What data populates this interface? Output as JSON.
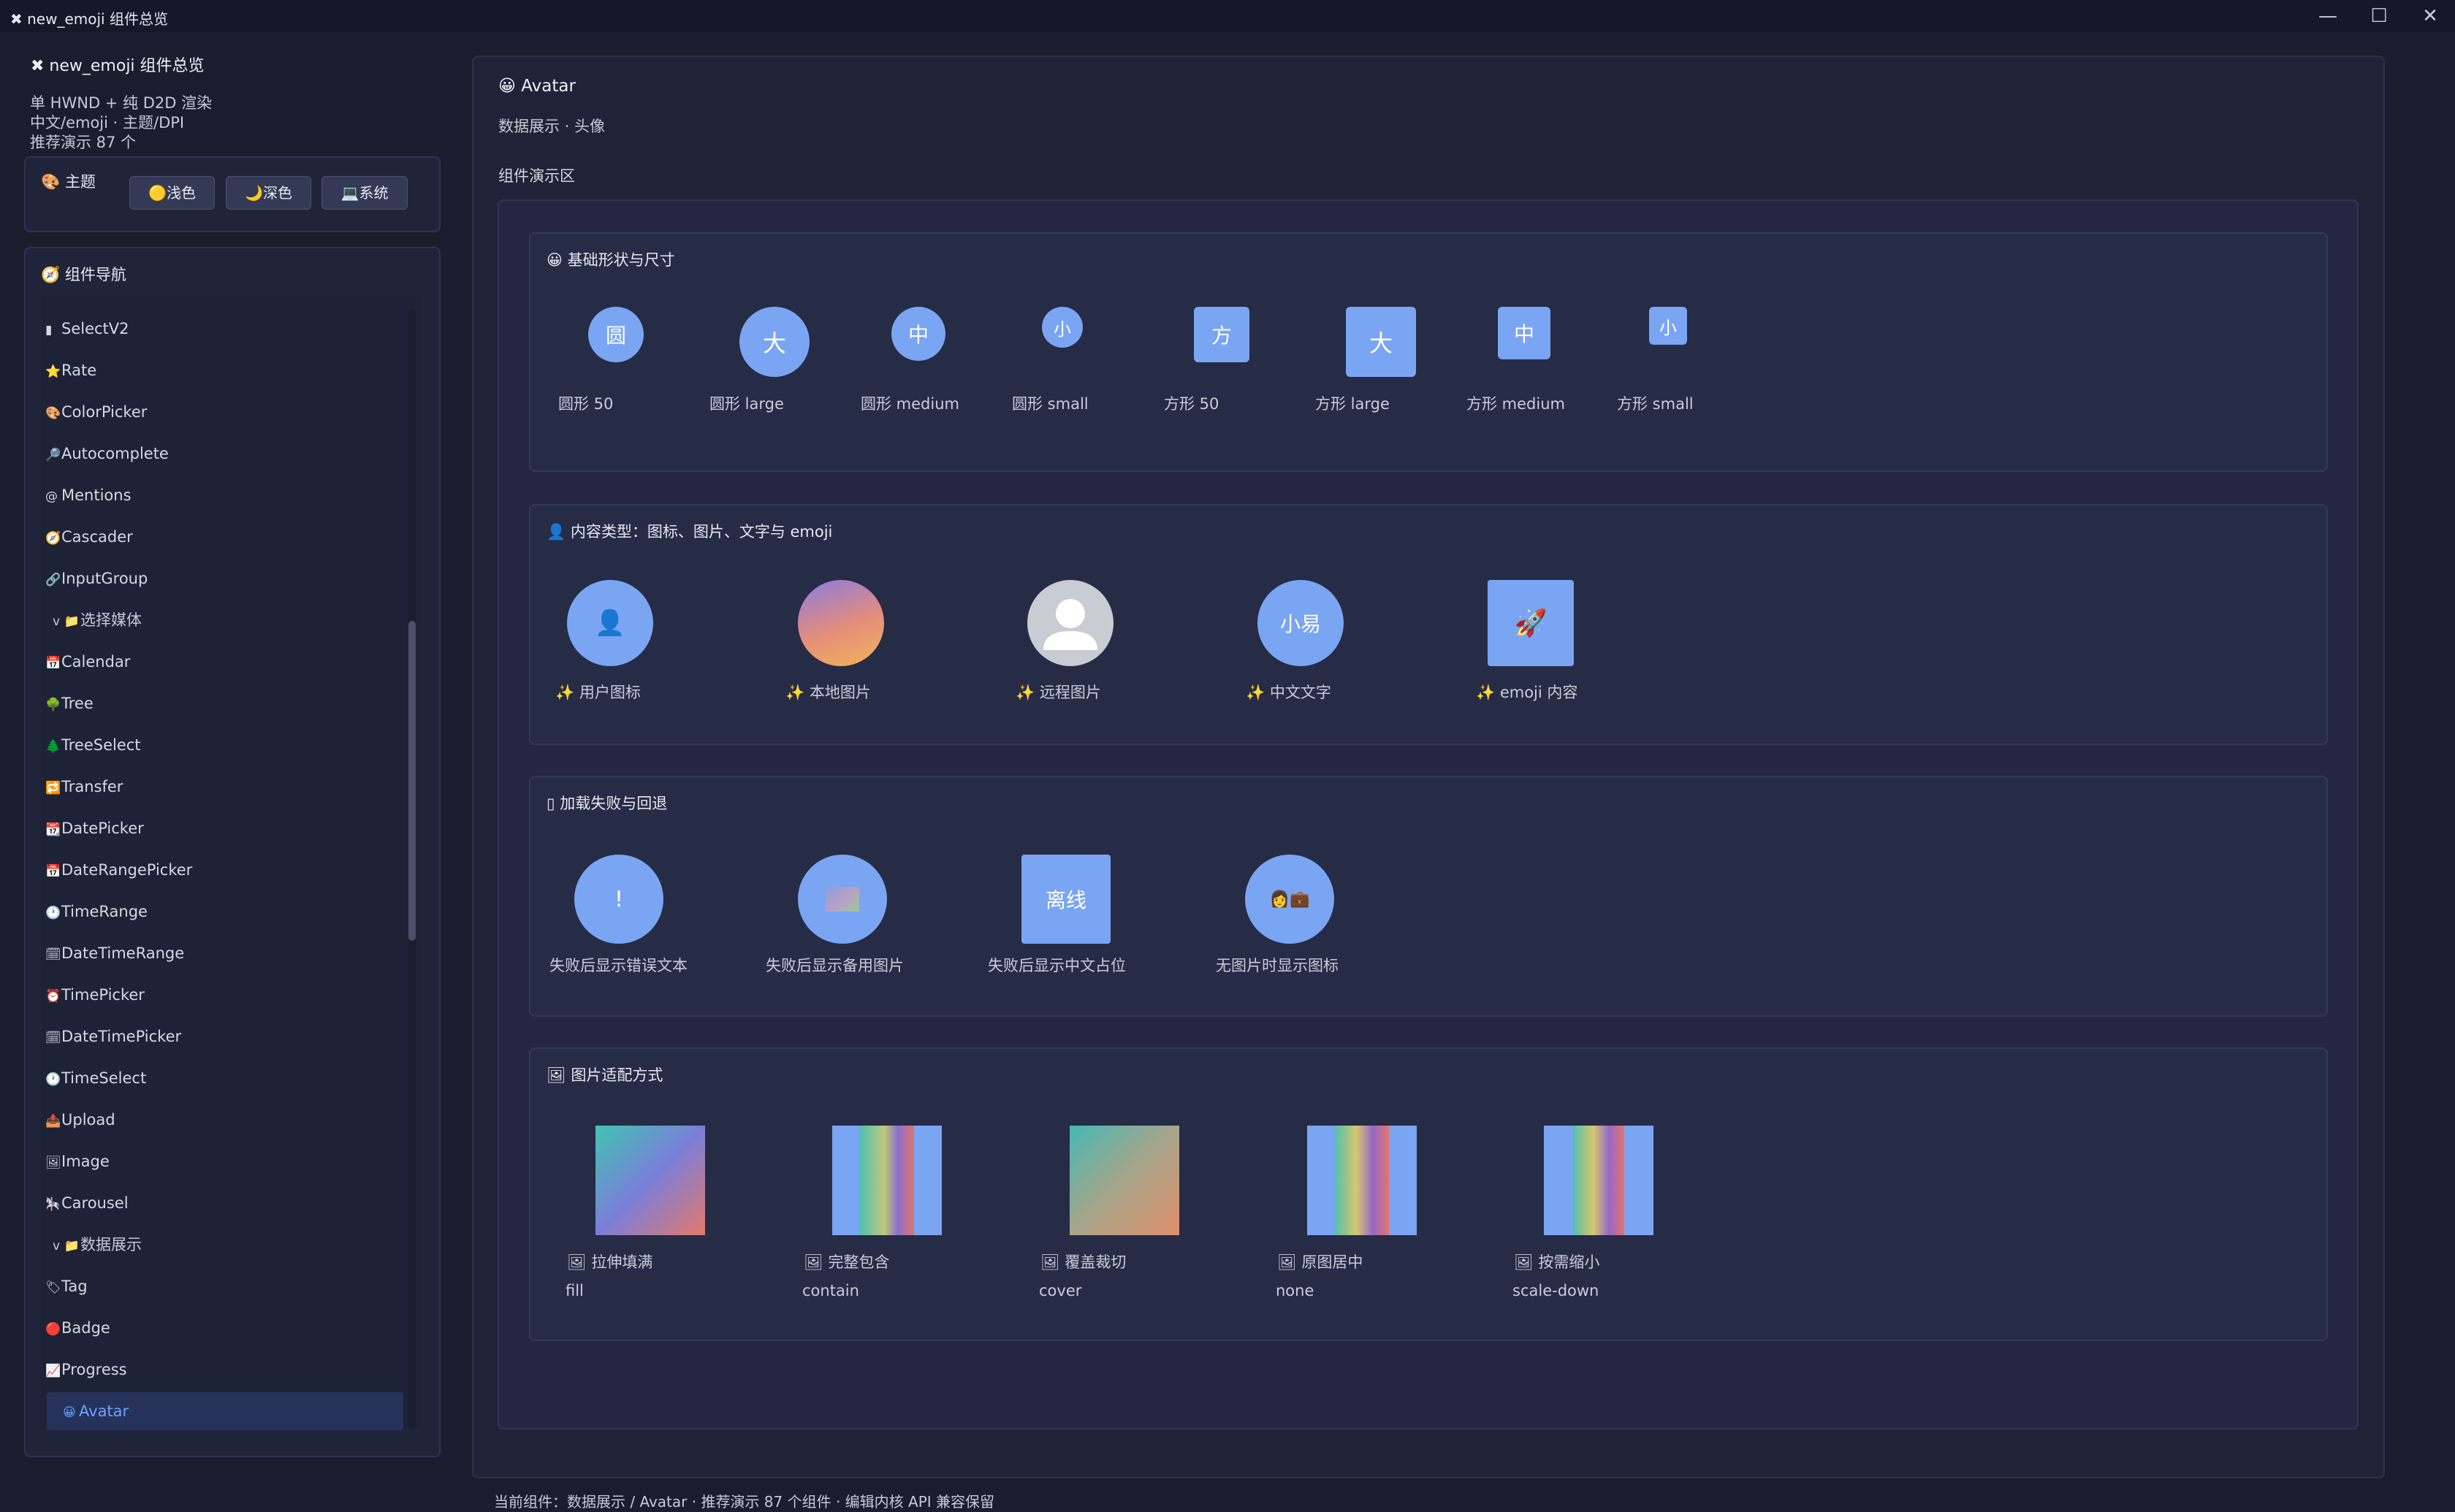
{
  "window": {
    "title": "✖ new_emoji 组件总览",
    "min": "—",
    "max": "☐",
    "close": "✕"
  },
  "sidebar": {
    "title": "✖ new_emoji 组件总览",
    "lines": [
      "单 HWND + 纯 D2D 渲染",
      "中文/emoji · 主题/DPI",
      "推荐演示 87 个"
    ],
    "theme": {
      "label": "🎨 主题",
      "buttons": [
        "🟡浅色",
        "🌙深色",
        "💻系统"
      ]
    },
    "nav": {
      "label": "🧭 组件导航",
      "items": [
        {
          "icon": "▮",
          "label": "SelectV2"
        },
        {
          "icon": "⭐",
          "label": "Rate"
        },
        {
          "icon": "🎨",
          "label": "ColorPicker"
        },
        {
          "icon": "🔎",
          "label": "Autocomplete"
        },
        {
          "icon": "@",
          "label": "Mentions"
        },
        {
          "icon": "🧭",
          "label": "Cascader"
        },
        {
          "icon": "🔗",
          "label": "InputGroup"
        },
        {
          "icon": "v 📁",
          "label": "选择媒体",
          "group": true
        },
        {
          "icon": "📅",
          "label": "Calendar"
        },
        {
          "icon": "🌳",
          "label": "Tree"
        },
        {
          "icon": "🌲",
          "label": "TreeSelect"
        },
        {
          "icon": "🔁",
          "label": "Transfer"
        },
        {
          "icon": "📆",
          "label": "DatePicker"
        },
        {
          "icon": "📅",
          "label": "DateRangePicker"
        },
        {
          "icon": "🕐",
          "label": "TimeRange"
        },
        {
          "icon": "🗓",
          "label": "DateTimeRange"
        },
        {
          "icon": "⏰",
          "label": "TimePicker"
        },
        {
          "icon": "🗓",
          "label": "DateTimePicker"
        },
        {
          "icon": "🕐",
          "label": "TimeSelect"
        },
        {
          "icon": "📤",
          "label": "Upload"
        },
        {
          "icon": "🖼",
          "label": "Image"
        },
        {
          "icon": "🎠",
          "label": "Carousel"
        },
        {
          "icon": "v 📁",
          "label": "数据展示",
          "group": true
        },
        {
          "icon": "🏷",
          "label": "Tag"
        },
        {
          "icon": "🔴",
          "label": "Badge"
        },
        {
          "icon": "📈",
          "label": "Progress"
        },
        {
          "icon": "😀",
          "label": "Avatar",
          "active": true
        }
      ]
    }
  },
  "main": {
    "title": "😀 Avatar",
    "subtitle": "数据展示 · 头像",
    "demo_label": "组件演示区",
    "sections": {
      "shapes": {
        "title": "😀 基础形状与尺寸",
        "items": [
          {
            "text": "圆",
            "caption": "圆形 50"
          },
          {
            "text": "大",
            "caption": "圆形 large"
          },
          {
            "text": "中",
            "caption": "圆形 medium"
          },
          {
            "text": "小",
            "caption": "圆形 small"
          },
          {
            "text": "方",
            "caption": "方形 50"
          },
          {
            "text": "大",
            "caption": "方形 large"
          },
          {
            "text": "中",
            "caption": "方形 medium"
          },
          {
            "text": "小",
            "caption": "方形 small"
          }
        ]
      },
      "content": {
        "title": "👤 内容类型：图标、图片、文字与 emoji",
        "items": [
          {
            "text": "👤",
            "caption": "✨ 用户图标"
          },
          {
            "text": "",
            "caption": "✨ 本地图片"
          },
          {
            "text": "",
            "caption": "✨ 远程图片"
          },
          {
            "text": "小易",
            "caption": "✨ 中文文字"
          },
          {
            "text": "🚀",
            "caption": "✨ emoji 内容"
          }
        ]
      },
      "fallback": {
        "title": "▯ 加载失败与回退",
        "items": [
          {
            "text": "!",
            "caption": "失败后显示错误文本"
          },
          {
            "text": "",
            "caption": "失败后显示备用图片"
          },
          {
            "text": "离线",
            "caption": "失败后显示中文占位"
          },
          {
            "text": "👩💼",
            "caption": "无图片时显示图标"
          }
        ]
      },
      "fit": {
        "title": "🖼 图片适配方式",
        "items": [
          {
            "caption": "🖼 拉伸填满",
            "mode": "fill"
          },
          {
            "caption": "🖼 完整包含",
            "mode": "contain"
          },
          {
            "caption": "🖼 覆盖裁切",
            "mode": "cover"
          },
          {
            "caption": "🖼 原图居中",
            "mode": "none"
          },
          {
            "caption": "🖼 按需缩小",
            "mode": "scale-down"
          }
        ]
      }
    }
  },
  "footer": "当前组件：数据展示 / Avatar · 推荐演示 87 个组件 · 编辑内核 API 兼容保留"
}
